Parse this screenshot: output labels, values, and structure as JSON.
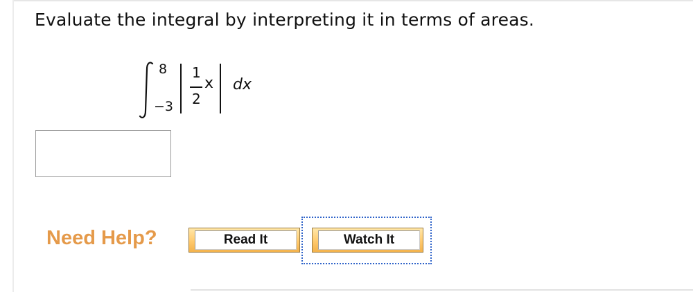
{
  "question": {
    "text": "Evaluate the integral by interpreting it in terms of areas."
  },
  "integral": {
    "upper_limit": "8",
    "lower_limit": "−3",
    "numerator": "1",
    "denominator": "2",
    "variable": "x",
    "differential": "dx"
  },
  "answer": {
    "value": "",
    "placeholder": ""
  },
  "help": {
    "label": "Need Help?",
    "buttons": {
      "read_it": "Read It",
      "watch_it": "Watch It"
    }
  },
  "colors": {
    "help_text": "#e59a4a",
    "button_face": "#ffca6e",
    "focus_ring": "#2f63c9"
  }
}
